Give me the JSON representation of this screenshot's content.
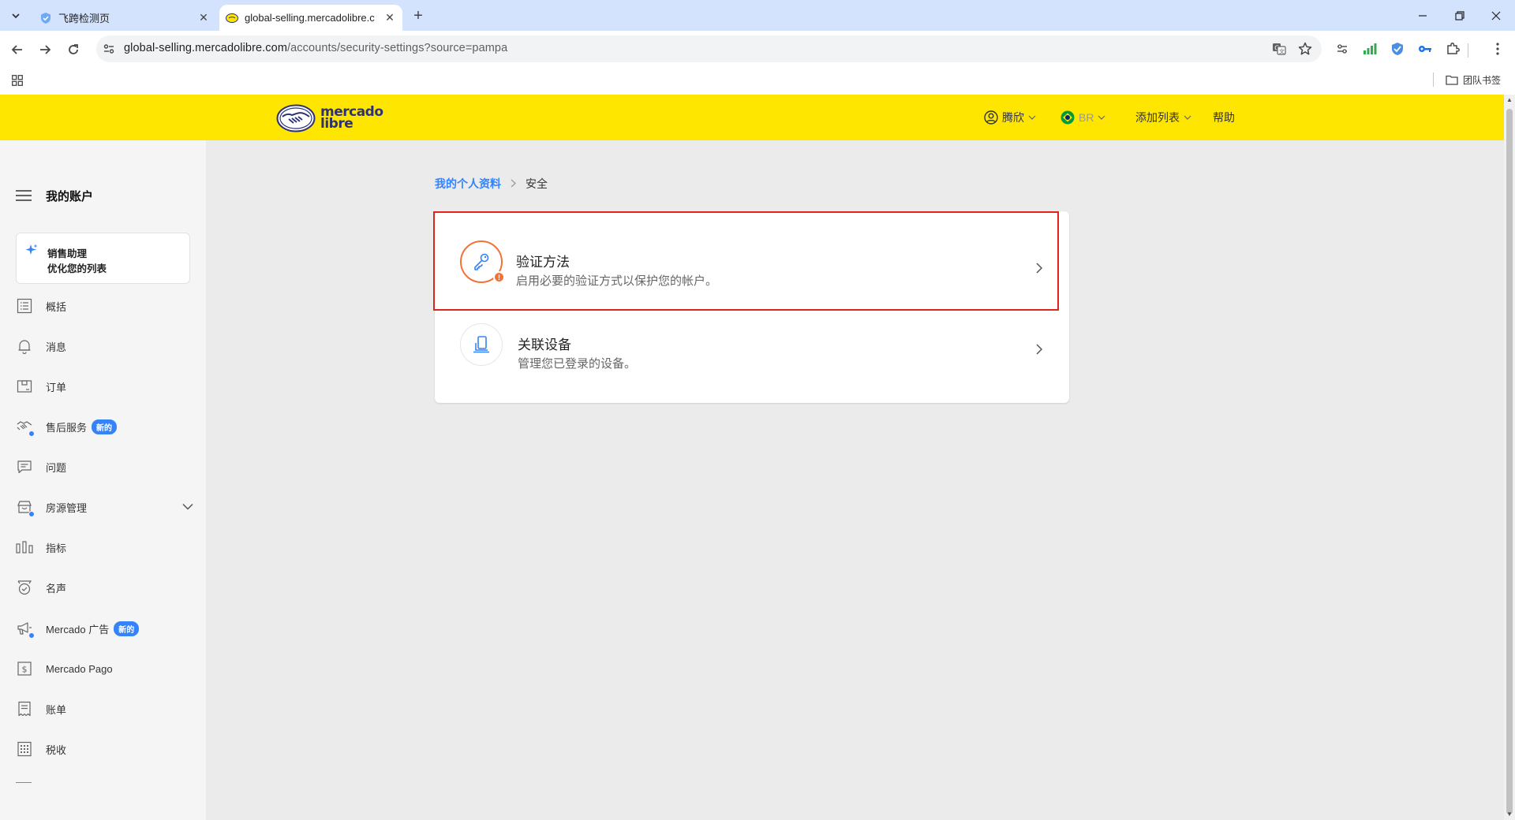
{
  "browser": {
    "tabs": [
      {
        "title": "飞跨检测页",
        "active": false
      },
      {
        "title": "global-selling.mercadolibre.c",
        "active": true
      }
    ],
    "url_host": "global-selling.mercadolibre.com",
    "url_path": "/accounts/security-settings?source=pampa",
    "bookmark_folder": "团队书签"
  },
  "header": {
    "logo_line1": "mercado",
    "logo_line2": "libre",
    "user": "腾欣",
    "site": "BR",
    "add_listing": "添加列表",
    "help": "帮助"
  },
  "sidebar": {
    "title": "我的账户",
    "assistant_title": "销售助理",
    "assistant_subtitle": "优化您的列表",
    "items": [
      {
        "label": "概括",
        "icon": "list-icon"
      },
      {
        "label": "消息",
        "icon": "bell-icon"
      },
      {
        "label": "订单",
        "icon": "box-icon"
      },
      {
        "label": "售后服务",
        "icon": "handshake-icon",
        "badge": "新的"
      },
      {
        "label": "问题",
        "icon": "chat-icon"
      },
      {
        "label": "房源管理",
        "icon": "store-icon"
      },
      {
        "label": "指标",
        "icon": "bar-chart-icon"
      },
      {
        "label": "名声",
        "icon": "medal-icon"
      },
      {
        "label": "Mercado 广告",
        "icon": "megaphone-icon",
        "badge": "新的"
      },
      {
        "label": "Mercado Pago",
        "icon": "dollar-icon"
      },
      {
        "label": "账单",
        "icon": "receipt-icon"
      },
      {
        "label": "税收",
        "icon": "calculator-icon"
      }
    ]
  },
  "breadcrumb": {
    "parent": "我的个人资料",
    "current": "安全"
  },
  "security": {
    "rows": [
      {
        "title": "验证方法",
        "description": "启用必要的验证方式以保护您的帐户。",
        "icon": "key-icon",
        "warning": "!"
      },
      {
        "title": "关联设备",
        "description": "管理您已登录的设备。",
        "icon": "devices-icon"
      }
    ]
  },
  "colors": {
    "brand_yellow": "#ffe600",
    "link_blue": "#3483fa",
    "warning_orange": "#f37235",
    "highlight_red": "#e0231b"
  }
}
